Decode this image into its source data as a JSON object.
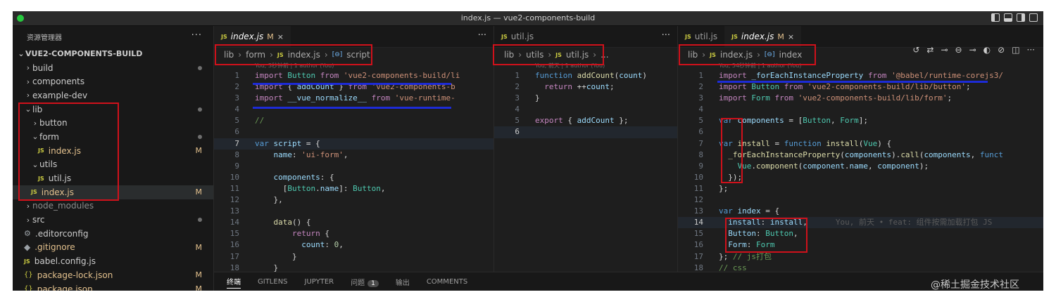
{
  "window": {
    "title": "index.js — vue2-components-build"
  },
  "sidebar": {
    "header": "资源管理器",
    "more": "···",
    "root": "VUE2-COMPONENTS-BUILD",
    "items": [
      {
        "label": "build",
        "type": "folder",
        "dot": true
      },
      {
        "label": "components",
        "type": "folder"
      },
      {
        "label": "example-dev",
        "type": "folder"
      },
      {
        "label": "lib",
        "type": "folder-open",
        "dot": true
      },
      {
        "label": "button",
        "type": "folder"
      },
      {
        "label": "form",
        "type": "folder-open",
        "dot": true
      },
      {
        "label": "index.js",
        "type": "js",
        "badge": "M"
      },
      {
        "label": "utils",
        "type": "folder-open"
      },
      {
        "label": "util.js",
        "type": "js"
      },
      {
        "label": "index.js",
        "type": "js",
        "badge": "M"
      },
      {
        "label": "node_modules",
        "type": "folder"
      },
      {
        "label": "src",
        "type": "folder",
        "dot": true
      },
      {
        "label": ".editorconfig",
        "type": "gear"
      },
      {
        "label": ".gitignore",
        "type": "dotfile",
        "badge": "M"
      },
      {
        "label": "babel.config.js",
        "type": "js"
      },
      {
        "label": "package-lock.json",
        "type": "json",
        "badge": "M"
      },
      {
        "label": "package.json",
        "type": "json",
        "badge": "M"
      }
    ]
  },
  "pane1": {
    "tab": {
      "name": "index.js",
      "mod": "M",
      "close": "×"
    },
    "crumbs": [
      "lib",
      "form",
      "index.js",
      "script"
    ],
    "blame": "You, 3秒钟前 | 1 author (You)",
    "lines": [
      {
        "n": "1",
        "t": [
          [
            "kw2",
            "import "
          ],
          [
            "cls",
            "Button "
          ],
          [
            "kw2",
            "from "
          ],
          [
            "str",
            "'vue2-components-build/li"
          ]
        ]
      },
      {
        "n": "2",
        "t": [
          [
            "kw2",
            "import "
          ],
          [
            "pl",
            "{ "
          ],
          [
            "var",
            "addCount "
          ],
          [
            "pl",
            "} "
          ],
          [
            "kw2",
            "from "
          ],
          [
            "str",
            "'vue2-components-b"
          ]
        ]
      },
      {
        "n": "3",
        "t": [
          [
            "kw2",
            "import "
          ],
          [
            "var",
            "__vue_normalize__ "
          ],
          [
            "kw2",
            "from "
          ],
          [
            "str",
            "'vue-runtime-"
          ]
        ]
      },
      {
        "n": "4",
        "t": []
      },
      {
        "n": "5",
        "t": [
          [
            "cmt",
            "//"
          ]
        ]
      },
      {
        "n": "6",
        "t": []
      },
      {
        "n": "7",
        "t": [
          [
            "kw",
            "var "
          ],
          [
            "var",
            "script "
          ],
          [
            "pl",
            "= {"
          ]
        ]
      },
      {
        "n": "8",
        "t": [
          [
            "pl",
            "    "
          ],
          [
            "var",
            "name"
          ],
          [
            "pl",
            ": "
          ],
          [
            "str",
            "'ui-form'"
          ],
          [
            "pl",
            ","
          ]
        ]
      },
      {
        "n": "9",
        "t": []
      },
      {
        "n": "10",
        "t": [
          [
            "pl",
            "    "
          ],
          [
            "var",
            "components"
          ],
          [
            "pl",
            ": {"
          ]
        ]
      },
      {
        "n": "11",
        "t": [
          [
            "pl",
            "      ["
          ],
          [
            "cls",
            "Button"
          ],
          [
            "pl",
            "."
          ],
          [
            "var",
            "name"
          ],
          [
            "pl",
            "]: "
          ],
          [
            "cls",
            "Button"
          ],
          [
            "pl",
            ","
          ]
        ]
      },
      {
        "n": "12",
        "t": [
          [
            "pl",
            "    },"
          ]
        ]
      },
      {
        "n": "13",
        "t": []
      },
      {
        "n": "14",
        "t": [
          [
            "pl",
            "    "
          ],
          [
            "fn",
            "data"
          ],
          [
            "pl",
            "() {"
          ]
        ]
      },
      {
        "n": "15",
        "t": [
          [
            "pl",
            "        "
          ],
          [
            "kw2",
            "return "
          ],
          [
            "pl",
            "{"
          ]
        ]
      },
      {
        "n": "16",
        "t": [
          [
            "pl",
            "          "
          ],
          [
            "var",
            "count"
          ],
          [
            "pl",
            ": "
          ],
          [
            "num",
            "0"
          ],
          [
            "pl",
            ","
          ]
        ]
      },
      {
        "n": "17",
        "t": [
          [
            "pl",
            "        }"
          ]
        ]
      },
      {
        "n": "18",
        "t": [
          [
            "pl",
            "    }"
          ]
        ]
      }
    ]
  },
  "pane2": {
    "tab": {
      "name": "util.js",
      "close": ""
    },
    "crumbs": [
      "lib",
      "utils",
      "util.js",
      "..."
    ],
    "blame": "You, 前天 | 1 author (You)",
    "lines": [
      {
        "n": "1",
        "t": [
          [
            "kw",
            "function "
          ],
          [
            "fn",
            "addCount"
          ],
          [
            "pl",
            "("
          ],
          [
            "var",
            "count"
          ],
          [
            "pl",
            ")"
          ]
        ]
      },
      {
        "n": "2",
        "t": [
          [
            "pl",
            "  "
          ],
          [
            "kw2",
            "return "
          ],
          [
            "pl",
            "++"
          ],
          [
            "var",
            "count"
          ],
          [
            "pl",
            ";"
          ]
        ]
      },
      {
        "n": "3",
        "t": [
          [
            "pl",
            "}"
          ]
        ]
      },
      {
        "n": "4",
        "t": []
      },
      {
        "n": "5",
        "t": [
          [
            "kw2",
            "export "
          ],
          [
            "pl",
            "{ "
          ],
          [
            "var",
            "addCount "
          ],
          [
            "pl",
            "};"
          ]
        ]
      },
      {
        "n": "6",
        "t": []
      }
    ]
  },
  "pane3": {
    "tabs": [
      {
        "name": "util.js",
        "mod": "",
        "close": ""
      },
      {
        "name": "index.js",
        "mod": "M",
        "close": "×"
      }
    ],
    "crumbs": [
      "lib",
      "index.js",
      "index"
    ],
    "blame": "You, 54秒钟前 | 1 author (You)",
    "inline_blame": "You, 前天 • feat: 组件按需加载打包 JS",
    "lines": [
      {
        "n": "1",
        "t": [
          [
            "kw2",
            "import "
          ],
          [
            "var",
            "_forEachInstanceProperty "
          ],
          [
            "kw2",
            "from "
          ],
          [
            "str",
            "'@babel/runtime-corejs3/"
          ]
        ]
      },
      {
        "n": "2",
        "t": [
          [
            "kw2",
            "import "
          ],
          [
            "cls",
            "Button "
          ],
          [
            "kw2",
            "from "
          ],
          [
            "str",
            "'vue2-components-build/lib/button'"
          ],
          [
            "pl",
            ";"
          ]
        ]
      },
      {
        "n": "3",
        "t": [
          [
            "kw2",
            "import "
          ],
          [
            "cls",
            "Form "
          ],
          [
            "kw2",
            "from "
          ],
          [
            "str",
            "'vue2-components-build/lib/form'"
          ],
          [
            "pl",
            ";"
          ]
        ]
      },
      {
        "n": "4",
        "t": []
      },
      {
        "n": "5",
        "t": [
          [
            "kw",
            "var "
          ],
          [
            "var",
            "components "
          ],
          [
            "pl",
            "= ["
          ],
          [
            "cls",
            "Button"
          ],
          [
            "pl",
            ", "
          ],
          [
            "cls",
            "Form"
          ],
          [
            "pl",
            "];"
          ]
        ]
      },
      {
        "n": "6",
        "t": []
      },
      {
        "n": "7",
        "t": [
          [
            "kw",
            "var "
          ],
          [
            "fn",
            "install "
          ],
          [
            "pl",
            "= "
          ],
          [
            "kw",
            "function "
          ],
          [
            "fn",
            "install"
          ],
          [
            "pl",
            "("
          ],
          [
            "cls",
            "Vue"
          ],
          [
            "pl",
            ") {"
          ]
        ]
      },
      {
        "n": "8",
        "t": [
          [
            "pl",
            "  "
          ],
          [
            "fn",
            "_forEachInstanceProperty"
          ],
          [
            "pl",
            "("
          ],
          [
            "var",
            "components"
          ],
          [
            "pl",
            ")."
          ],
          [
            "fn",
            "call"
          ],
          [
            "pl",
            "("
          ],
          [
            "var",
            "components"
          ],
          [
            "pl",
            ", "
          ],
          [
            "kw",
            "funct"
          ]
        ]
      },
      {
        "n": "9",
        "t": [
          [
            "pl",
            "    "
          ],
          [
            "cls",
            "Vue"
          ],
          [
            "pl",
            "."
          ],
          [
            "fn",
            "component"
          ],
          [
            "pl",
            "("
          ],
          [
            "var",
            "component"
          ],
          [
            "pl",
            "."
          ],
          [
            "var",
            "name"
          ],
          [
            "pl",
            ", "
          ],
          [
            "var",
            "component"
          ],
          [
            "pl",
            ");"
          ]
        ]
      },
      {
        "n": "10",
        "t": [
          [
            "pl",
            "  });"
          ]
        ]
      },
      {
        "n": "11",
        "t": [
          [
            "pl",
            "};"
          ]
        ]
      },
      {
        "n": "12",
        "t": []
      },
      {
        "n": "13",
        "t": [
          [
            "kw",
            "var "
          ],
          [
            "var",
            "index "
          ],
          [
            "pl",
            "= {"
          ]
        ]
      },
      {
        "n": "14",
        "t": [
          [
            "pl",
            "  "
          ],
          [
            "var",
            "install"
          ],
          [
            "pl",
            ": "
          ],
          [
            "var",
            "install"
          ],
          [
            "pl",
            ","
          ]
        ]
      },
      {
        "n": "15",
        "t": [
          [
            "pl",
            "  "
          ],
          [
            "var",
            "Button"
          ],
          [
            "pl",
            ": "
          ],
          [
            "cls",
            "Button"
          ],
          [
            "pl",
            ","
          ]
        ]
      },
      {
        "n": "16",
        "t": [
          [
            "pl",
            "  "
          ],
          [
            "var",
            "Form"
          ],
          [
            "pl",
            ": "
          ],
          [
            "cls",
            "Form"
          ]
        ]
      },
      {
        "n": "17",
        "t": [
          [
            "pl",
            "}; "
          ],
          [
            "cmt",
            "// js打包"
          ]
        ]
      },
      {
        "n": "18",
        "t": [
          [
            "cmt",
            "// css"
          ]
        ]
      }
    ]
  },
  "panel": {
    "tabs": [
      "终端",
      "GITLENS",
      "JUPYTER",
      "问题",
      "输出",
      "COMMENTS"
    ],
    "problems_count": "1"
  },
  "watermark": "@稀土掘金技术社区",
  "colors": {
    "annotation_red": "#d0111b",
    "annotation_blue": "#1d2bd6",
    "editor_bg": "#1e1e1e"
  }
}
